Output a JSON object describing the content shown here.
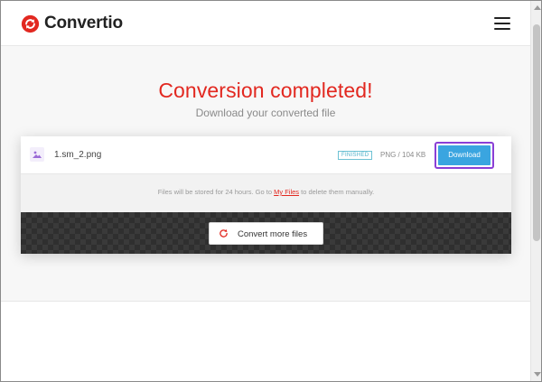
{
  "header": {
    "brand": "Convertio",
    "logo_icon": "convertio-logo-icon",
    "menu_icon": "hamburger-menu-icon"
  },
  "hero": {
    "title": "Conversion completed!",
    "subtitle": "Download your converted file"
  },
  "file": {
    "icon": "image-file-icon",
    "name": "1.sm_2.png",
    "status": "FINISHED",
    "meta": "PNG / 104 KB",
    "download_label": "Download"
  },
  "storage_note": {
    "before": "Files will be stored for 24 hours. Go to ",
    "link": "My Files",
    "after": " to delete them manually."
  },
  "actions": {
    "convert_more_label": "Convert more files",
    "convert_more_icon": "refresh-icon"
  },
  "colors": {
    "brand_red": "#e22820",
    "download_blue": "#3aa5e0",
    "highlight_purple": "#8a3fd6",
    "status_teal": "#4cb1c9"
  }
}
